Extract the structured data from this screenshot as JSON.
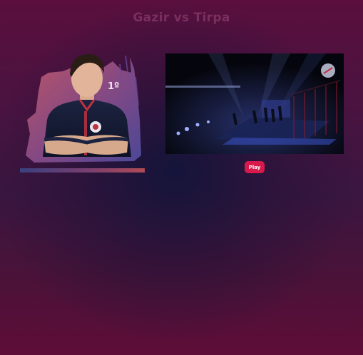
{
  "header": {
    "title": "Gazir vs Tirpa"
  },
  "player": {
    "rank": "1º"
  },
  "video": {
    "play_label": "Play"
  }
}
